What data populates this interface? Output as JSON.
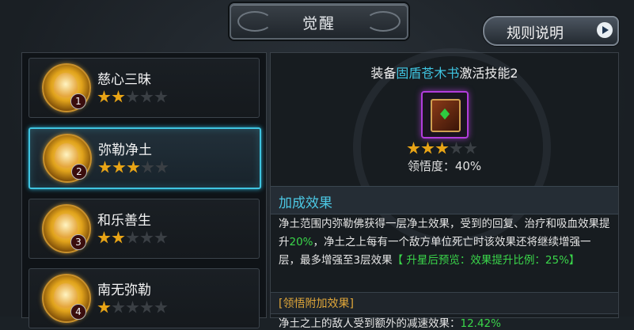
{
  "header": {
    "title": "觉醒",
    "rules_label": "规则说明"
  },
  "skills": [
    {
      "name": "慈心三昧",
      "level": "1",
      "stars_on": 2,
      "stars_total": 5
    },
    {
      "name": "弥勒净土",
      "level": "2",
      "stars_on": 3,
      "stars_total": 5
    },
    {
      "name": "和乐善生",
      "level": "3",
      "stars_on": 2,
      "stars_total": 5
    },
    {
      "name": "南无弥勒",
      "level": "4",
      "stars_on": 1,
      "stars_total": 5
    }
  ],
  "detail": {
    "equip_prefix": "装备",
    "equip_item": "固盾苍木书",
    "equip_suffix": "激活技能2",
    "item_stars_on": 3,
    "item_stars_total": 5,
    "insight": "领悟度：40%",
    "section_title": "加成效果",
    "desc_part1": "净土范围内弥勒佛获得一层净土效果，受到的回复、治疗和吸血效果提升",
    "desc_pct1": "20%",
    "desc_part2": "，净土之上每有一个敌方单位死亡时该效果还将继续增强一层，最多增强至3层效果",
    "desc_bracket": "【 升星后预览：效果提升比例：",
    "desc_pct2": "25%",
    "desc_bracket_end": "】",
    "sub_title": "[领悟附加效果]",
    "desc2_text": "净土之上的敌人受到额外的减速效果：",
    "desc2_pct": "12.42%"
  },
  "colors": {
    "accent_cyan": "#3fc4e0",
    "gold": "#e8a416",
    "green": "#3ad64a"
  }
}
